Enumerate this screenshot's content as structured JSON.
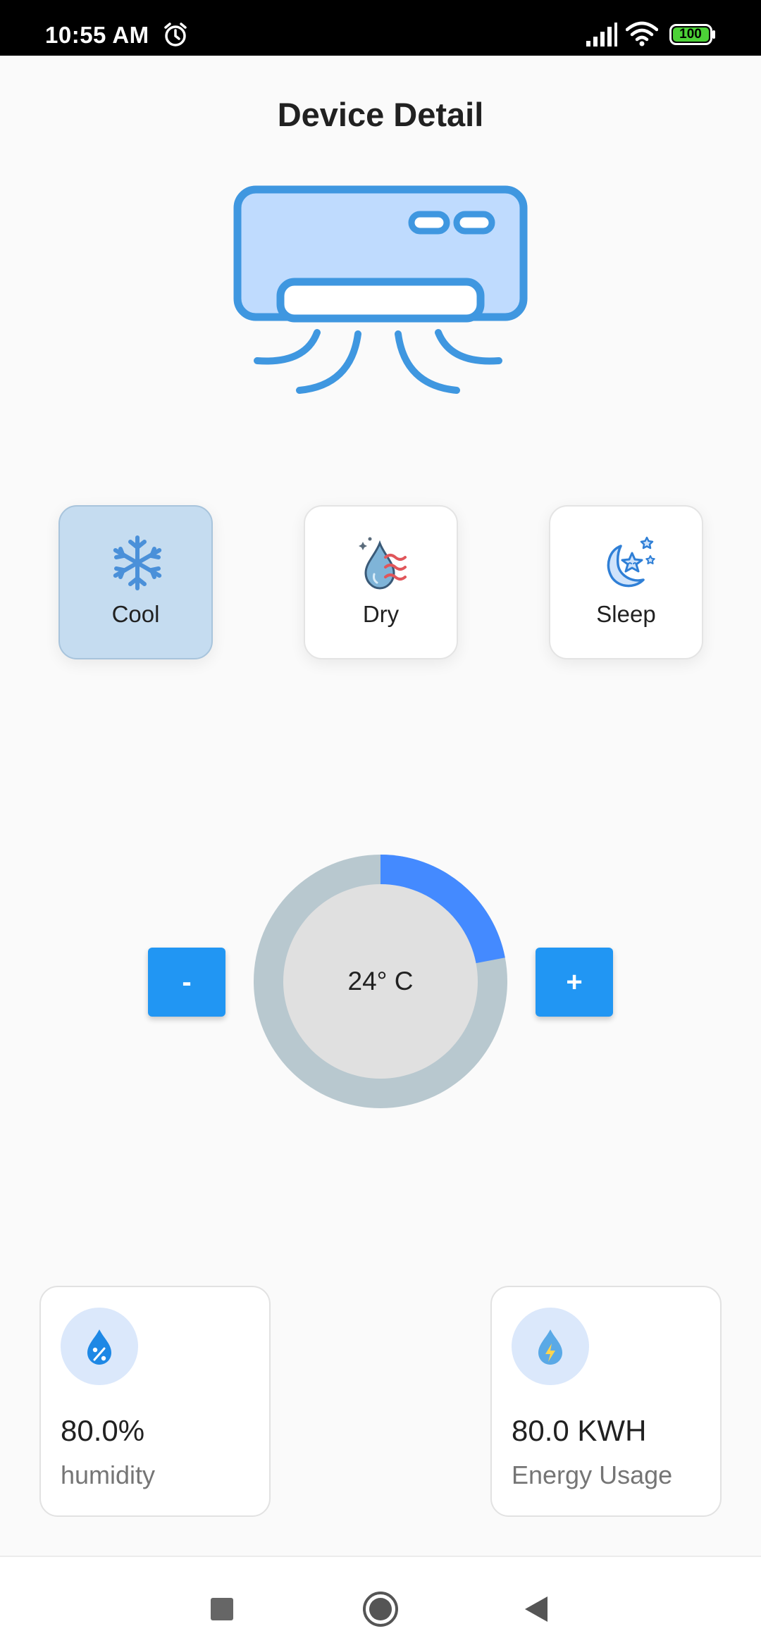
{
  "status_bar": {
    "time": "10:55 AM",
    "battery": "100",
    "icons": [
      "alarm-icon",
      "signal-icon",
      "wifi-icon",
      "battery-icon"
    ]
  },
  "header": {
    "title": "Device Detail"
  },
  "device": {
    "icon": "air-conditioner-icon",
    "color": "#3f97e0"
  },
  "modes": [
    {
      "label": "Cool",
      "icon": "snowflake-icon",
      "selected": true
    },
    {
      "label": "Dry",
      "icon": "dry-drop-icon",
      "selected": false
    },
    {
      "label": "Sleep",
      "icon": "moon-stars-icon",
      "selected": false
    }
  ],
  "temperature": {
    "value_label": "24° C",
    "decrease_label": "-",
    "increase_label": "+",
    "progress_fraction": 0.22,
    "progress_color": "#448aff",
    "track_color": "#b8c8cf",
    "inner_color": "#e0e0e0"
  },
  "stats": [
    {
      "value": "80.0%",
      "label": "humidity",
      "icon": "humidity-icon"
    },
    {
      "value": "80.0 KWH",
      "label": "Energy Usage",
      "icon": "energy-icon"
    }
  ],
  "nav_bar": {
    "icons": [
      "recents-icon",
      "home-icon",
      "back-icon"
    ]
  },
  "colors": {
    "accent": "#2196f3",
    "selected_card": "#c5dcf0"
  }
}
